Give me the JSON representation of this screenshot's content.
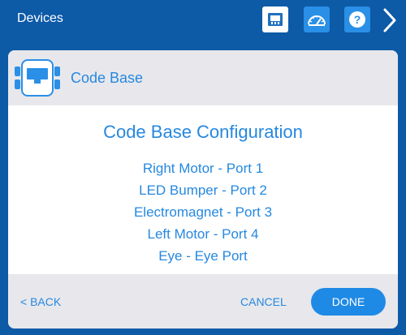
{
  "header": {
    "title": "Devices",
    "icons": [
      "ports-icon",
      "dashboard-icon",
      "help-icon",
      "chevron-right-icon"
    ]
  },
  "device": {
    "name": "Code Base",
    "icon": "code-base-brain-icon"
  },
  "configuration": {
    "title": "Code Base Configuration",
    "items": [
      "Right Motor - Port 1",
      "LED Bumper - Port 2",
      "Electromagnet - Port 3",
      "Left Motor - Port 4",
      "Eye - Eye Port"
    ]
  },
  "footer": {
    "back_label": "< BACK",
    "cancel_label": "CANCEL",
    "done_label": "DONE"
  },
  "colors": {
    "header_bg": "#0d5aa7",
    "accent": "#2688e0",
    "panel_gray": "#e8e8ec"
  }
}
